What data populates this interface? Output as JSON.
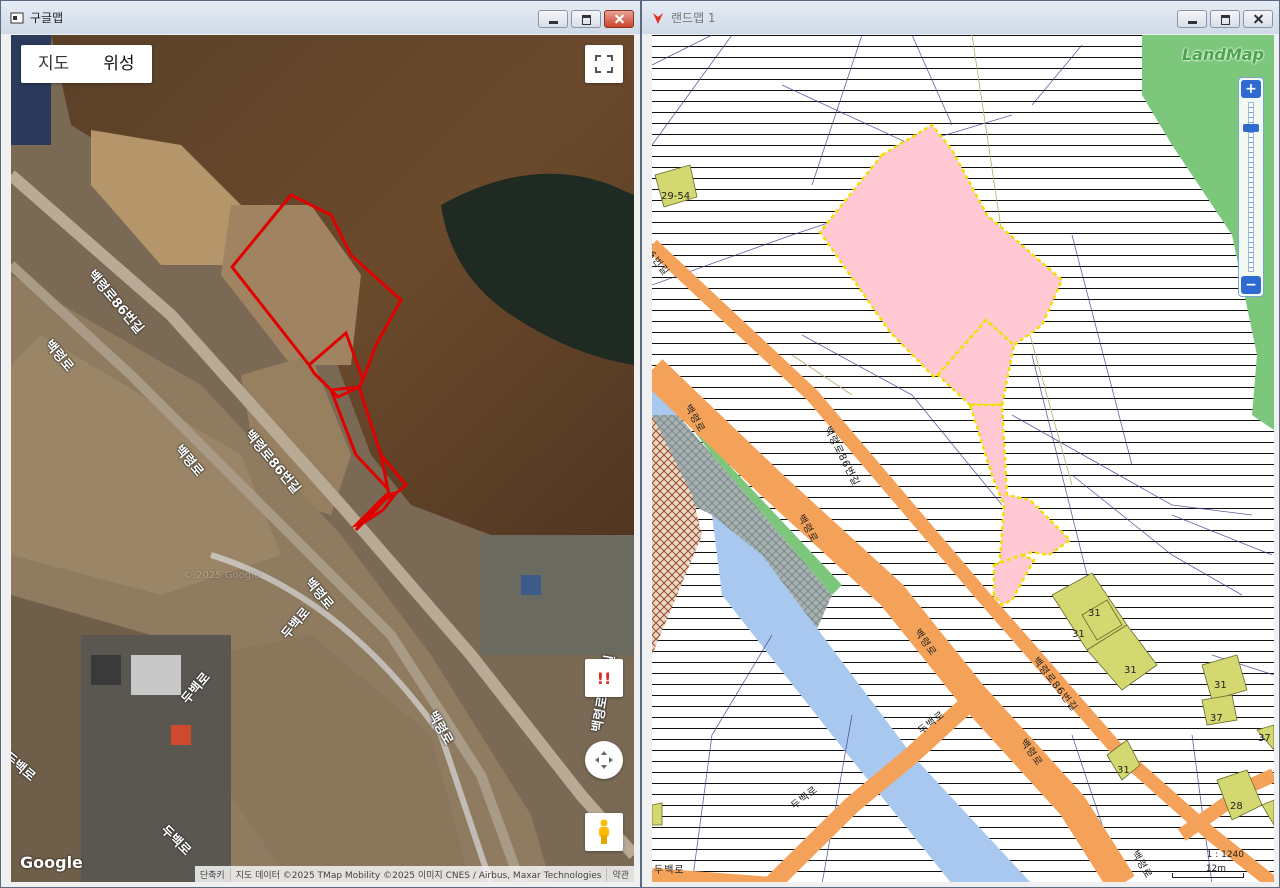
{
  "left_window": {
    "title": "구글맵",
    "map_type": {
      "map": "지도",
      "satellite": "위성"
    },
    "warning_label": "!!",
    "google_logo": "Google",
    "attribution": {
      "shortcuts": "단축키",
      "data": "지도 데이터 ©2025 TMap Mobility ©2025 이미지 CNES / Airbus, Maxar Technologies",
      "terms": "약관"
    },
    "road_labels": [
      "백령로86번길",
      "백령로",
      "백령로",
      "백령로86번길",
      "백령로",
      "두백로",
      "두백로",
      "백령로",
      "백령로86번길",
      "두백로",
      "두백로"
    ],
    "watermark": "© 2025 Google"
  },
  "right_window": {
    "title": "랜드맵 1",
    "logo": "LandMap",
    "zoom": {
      "in": "+",
      "out": "−"
    },
    "parcel_labels": [
      "29-54",
      "31",
      "31",
      "31",
      "31",
      "37",
      "37",
      "31",
      "28"
    ],
    "road_labels": [
      "6번길",
      "백령로",
      "백령로86번길",
      "백령로",
      "백령로",
      "백령로86번길",
      "두백로",
      "백령로",
      "두백로",
      "두백로",
      "백령로"
    ],
    "scale": "1 : 1240",
    "scale_unit": "12m"
  },
  "colors": {
    "parcel_red": "#e00000",
    "parcel_pink": "#ffc8d2",
    "parcel_yellow": "#f0e000",
    "road_orange": "#f4a25a",
    "green": "#7cc77c"
  }
}
